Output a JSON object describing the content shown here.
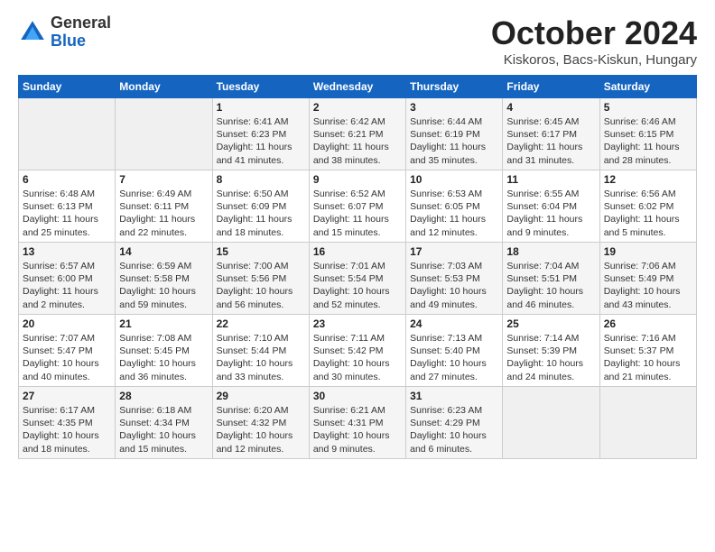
{
  "header": {
    "logo": {
      "line1": "General",
      "line2": "Blue"
    },
    "title": "October 2024",
    "subtitle": "Kiskoros, Bacs-Kiskun, Hungary"
  },
  "weekdays": [
    "Sunday",
    "Monday",
    "Tuesday",
    "Wednesday",
    "Thursday",
    "Friday",
    "Saturday"
  ],
  "weeks": [
    [
      {
        "day": "",
        "info": ""
      },
      {
        "day": "",
        "info": ""
      },
      {
        "day": "1",
        "info": "Sunrise: 6:41 AM\nSunset: 6:23 PM\nDaylight: 11 hours\nand 41 minutes."
      },
      {
        "day": "2",
        "info": "Sunrise: 6:42 AM\nSunset: 6:21 PM\nDaylight: 11 hours\nand 38 minutes."
      },
      {
        "day": "3",
        "info": "Sunrise: 6:44 AM\nSunset: 6:19 PM\nDaylight: 11 hours\nand 35 minutes."
      },
      {
        "day": "4",
        "info": "Sunrise: 6:45 AM\nSunset: 6:17 PM\nDaylight: 11 hours\nand 31 minutes."
      },
      {
        "day": "5",
        "info": "Sunrise: 6:46 AM\nSunset: 6:15 PM\nDaylight: 11 hours\nand 28 minutes."
      }
    ],
    [
      {
        "day": "6",
        "info": "Sunrise: 6:48 AM\nSunset: 6:13 PM\nDaylight: 11 hours\nand 25 minutes."
      },
      {
        "day": "7",
        "info": "Sunrise: 6:49 AM\nSunset: 6:11 PM\nDaylight: 11 hours\nand 22 minutes."
      },
      {
        "day": "8",
        "info": "Sunrise: 6:50 AM\nSunset: 6:09 PM\nDaylight: 11 hours\nand 18 minutes."
      },
      {
        "day": "9",
        "info": "Sunrise: 6:52 AM\nSunset: 6:07 PM\nDaylight: 11 hours\nand 15 minutes."
      },
      {
        "day": "10",
        "info": "Sunrise: 6:53 AM\nSunset: 6:05 PM\nDaylight: 11 hours\nand 12 minutes."
      },
      {
        "day": "11",
        "info": "Sunrise: 6:55 AM\nSunset: 6:04 PM\nDaylight: 11 hours\nand 9 minutes."
      },
      {
        "day": "12",
        "info": "Sunrise: 6:56 AM\nSunset: 6:02 PM\nDaylight: 11 hours\nand 5 minutes."
      }
    ],
    [
      {
        "day": "13",
        "info": "Sunrise: 6:57 AM\nSunset: 6:00 PM\nDaylight: 11 hours\nand 2 minutes."
      },
      {
        "day": "14",
        "info": "Sunrise: 6:59 AM\nSunset: 5:58 PM\nDaylight: 10 hours\nand 59 minutes."
      },
      {
        "day": "15",
        "info": "Sunrise: 7:00 AM\nSunset: 5:56 PM\nDaylight: 10 hours\nand 56 minutes."
      },
      {
        "day": "16",
        "info": "Sunrise: 7:01 AM\nSunset: 5:54 PM\nDaylight: 10 hours\nand 52 minutes."
      },
      {
        "day": "17",
        "info": "Sunrise: 7:03 AM\nSunset: 5:53 PM\nDaylight: 10 hours\nand 49 minutes."
      },
      {
        "day": "18",
        "info": "Sunrise: 7:04 AM\nSunset: 5:51 PM\nDaylight: 10 hours\nand 46 minutes."
      },
      {
        "day": "19",
        "info": "Sunrise: 7:06 AM\nSunset: 5:49 PM\nDaylight: 10 hours\nand 43 minutes."
      }
    ],
    [
      {
        "day": "20",
        "info": "Sunrise: 7:07 AM\nSunset: 5:47 PM\nDaylight: 10 hours\nand 40 minutes."
      },
      {
        "day": "21",
        "info": "Sunrise: 7:08 AM\nSunset: 5:45 PM\nDaylight: 10 hours\nand 36 minutes."
      },
      {
        "day": "22",
        "info": "Sunrise: 7:10 AM\nSunset: 5:44 PM\nDaylight: 10 hours\nand 33 minutes."
      },
      {
        "day": "23",
        "info": "Sunrise: 7:11 AM\nSunset: 5:42 PM\nDaylight: 10 hours\nand 30 minutes."
      },
      {
        "day": "24",
        "info": "Sunrise: 7:13 AM\nSunset: 5:40 PM\nDaylight: 10 hours\nand 27 minutes."
      },
      {
        "day": "25",
        "info": "Sunrise: 7:14 AM\nSunset: 5:39 PM\nDaylight: 10 hours\nand 24 minutes."
      },
      {
        "day": "26",
        "info": "Sunrise: 7:16 AM\nSunset: 5:37 PM\nDaylight: 10 hours\nand 21 minutes."
      }
    ],
    [
      {
        "day": "27",
        "info": "Sunrise: 6:17 AM\nSunset: 4:35 PM\nDaylight: 10 hours\nand 18 minutes."
      },
      {
        "day": "28",
        "info": "Sunrise: 6:18 AM\nSunset: 4:34 PM\nDaylight: 10 hours\nand 15 minutes."
      },
      {
        "day": "29",
        "info": "Sunrise: 6:20 AM\nSunset: 4:32 PM\nDaylight: 10 hours\nand 12 minutes."
      },
      {
        "day": "30",
        "info": "Sunrise: 6:21 AM\nSunset: 4:31 PM\nDaylight: 10 hours\nand 9 minutes."
      },
      {
        "day": "31",
        "info": "Sunrise: 6:23 AM\nSunset: 4:29 PM\nDaylight: 10 hours\nand 6 minutes."
      },
      {
        "day": "",
        "info": ""
      },
      {
        "day": "",
        "info": ""
      }
    ]
  ]
}
